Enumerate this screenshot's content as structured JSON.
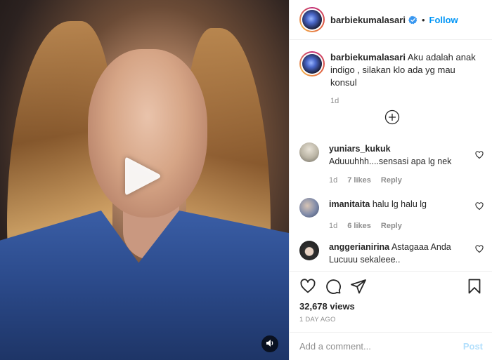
{
  "post": {
    "username": "barbiekumalasari",
    "follow_label": "Follow",
    "separator": "•"
  },
  "caption": {
    "username": "barbiekumalasari",
    "text": "Aku adalah anak indigo , silakan klo ada yg mau konsul",
    "time": "1d"
  },
  "comments": [
    {
      "username": "yuniars_kukuk",
      "text": "Aduuuhhh....sensasi apa lg nek",
      "time": "1d",
      "likes": "7 likes",
      "reply_label": "Reply",
      "avatar_color": "#b9b3a3"
    },
    {
      "username": "imanitaita",
      "text": "halu lg halu lg",
      "time": "1d",
      "likes": "6 likes",
      "reply_label": "Reply",
      "avatar_color": "#7f8aa8"
    },
    {
      "username": "anggerianirina",
      "text": "Astagaaa Anda Lucuuu sekaleee..",
      "avatar_color": "#2f2f2f"
    }
  ],
  "stats": {
    "views": "32,678 views",
    "date": "1 DAY AGO"
  },
  "comment_input": {
    "placeholder": "Add a comment...",
    "post_label": "Post"
  },
  "colors": {
    "link_blue": "#0095f6",
    "muted": "#8e8e8e",
    "post_disabled": "#b2dffc"
  },
  "icons": {
    "play": "play-icon",
    "sound": "sound-icon",
    "verified": "verified-badge-icon",
    "load_more": "plus-circle-icon",
    "heart": "heart-icon",
    "comment": "comment-icon",
    "share": "share-icon",
    "bookmark": "bookmark-icon"
  }
}
